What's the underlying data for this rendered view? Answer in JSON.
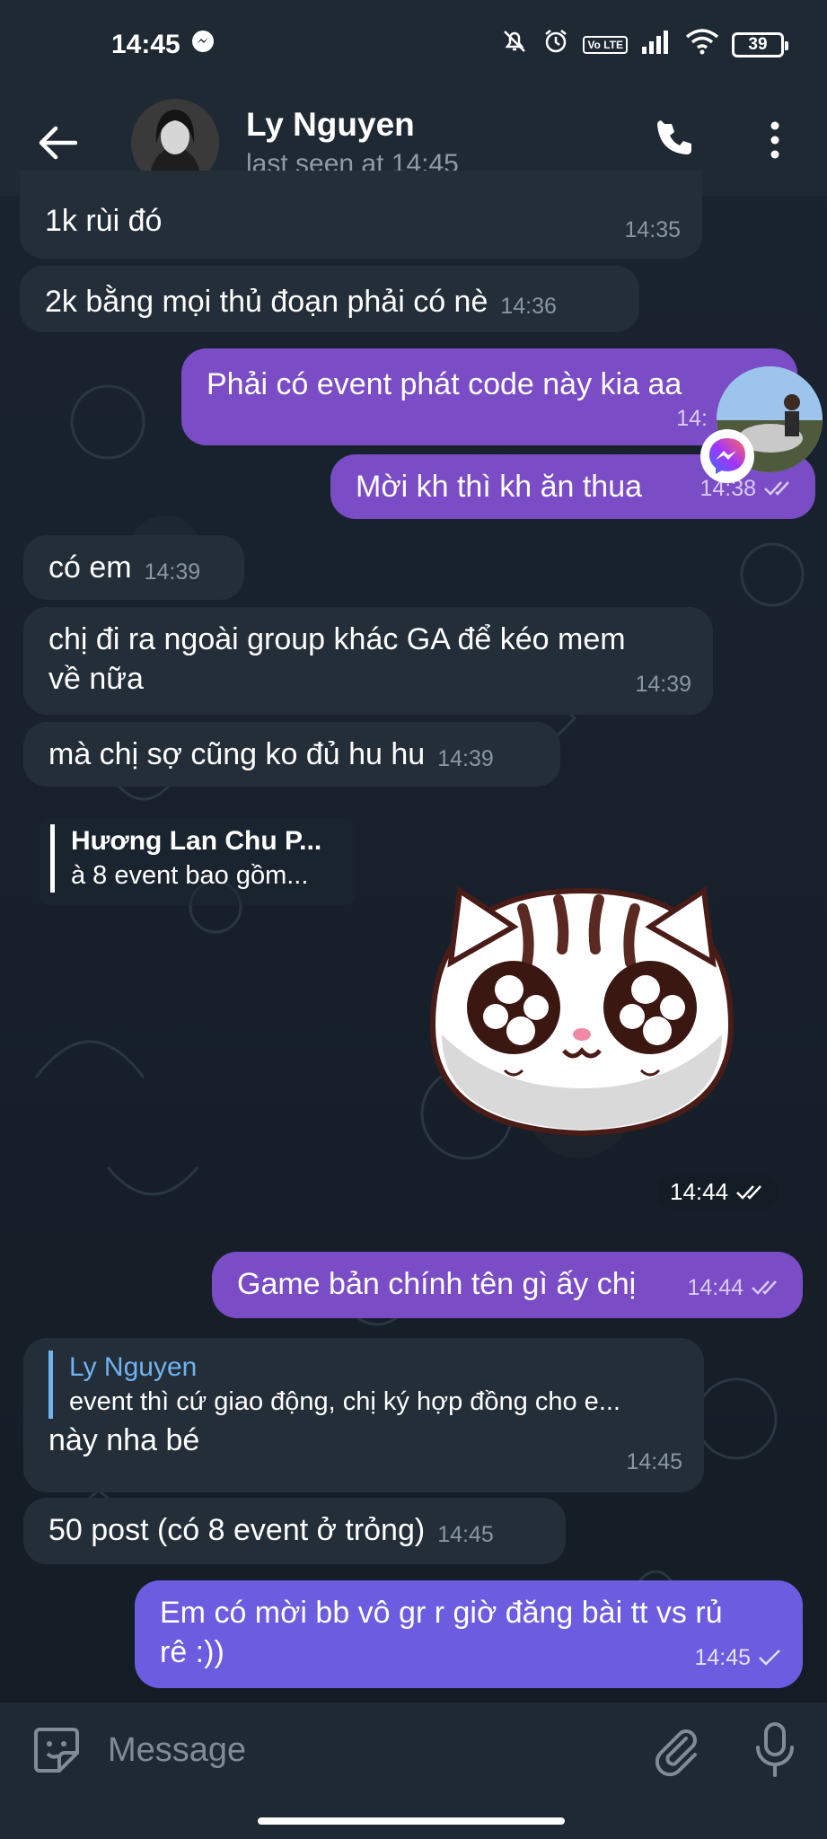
{
  "status_bar": {
    "time": "14:45",
    "battery": "39",
    "volte": "Vo LTE"
  },
  "header": {
    "contact_name": "Ly Nguyen",
    "last_seen": "last seen at 14:45"
  },
  "messages": [
    {
      "text": "1k rùi đó",
      "time": "14:35"
    },
    {
      "text": "2k bằng mọi thủ đoạn phải có nè",
      "time": "14:36"
    },
    {
      "text": "Phải có event phát code này kia aa",
      "time": "14:"
    },
    {
      "text": "Mời kh thì kh ăn thua",
      "time": "14:38"
    },
    {
      "text": "có em",
      "time": "14:39"
    },
    {
      "text_line1": "chị đi ra ngoài group khác GA để kéo mem",
      "text_line2": "về nữa",
      "time": "14:39"
    },
    {
      "text": "mà chị sợ cũng ko đủ hu hu",
      "time": "14:39"
    },
    {
      "reply_author": "Hương Lan Chu P...",
      "reply_text": "à 8 event bao gồm...",
      "time": "14:44"
    },
    {
      "text": "Game bản chính tên gì ấy chị",
      "time": "14:44"
    },
    {
      "reply_author": "Ly Nguyen",
      "reply_text": "event thì cứ giao động, chị ký hợp đồng cho e...",
      "text": "này nha bé",
      "time": "14:45"
    },
    {
      "text": "50 post (có 8 event ở trỏng)",
      "time": "14:45"
    },
    {
      "text_line1": "Em có mời bb vô gr r giờ đăng bài tt vs rủ",
      "text_line2": "rê :))",
      "time": "14:45"
    }
  ],
  "input": {
    "placeholder": "Message"
  },
  "icons": {
    "back": "arrow-left-icon",
    "call": "phone-icon",
    "menu": "more-vertical-icon",
    "emoji": "sticker-icon",
    "attach": "paperclip-icon",
    "mic": "microphone-icon",
    "read": "double-check-icon",
    "sent": "check-icon"
  },
  "colors": {
    "incoming_bubble": "#232e39",
    "outgoing_bubble": "#7a4cc6",
    "outgoing_bubble_latest": "#6b5ce0",
    "reply_author_blue": "#6fb3f0",
    "background": "#17202a"
  }
}
